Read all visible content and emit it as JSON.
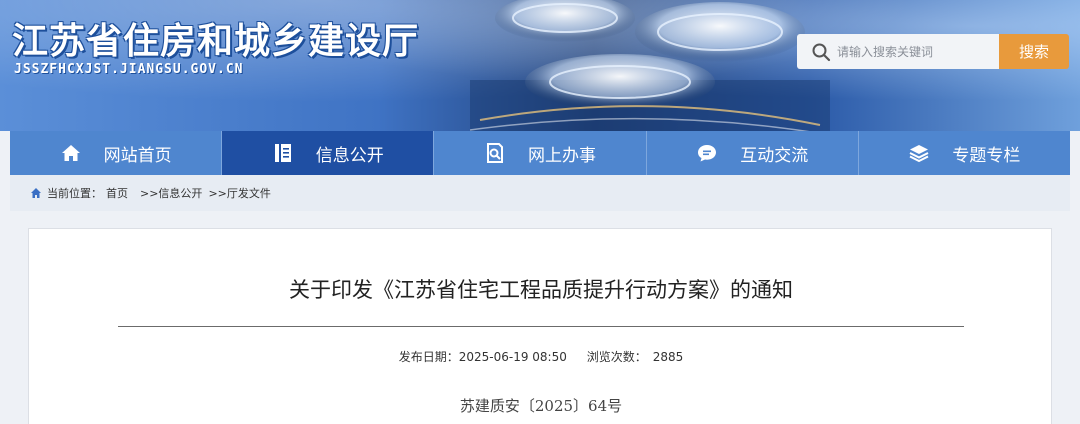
{
  "header": {
    "site_title": "江苏省住房和城乡建设厅",
    "site_domain": "JSSZFHCXJST.JIANGSU.GOV.CN",
    "search": {
      "placeholder": "请输入搜索关键词",
      "button_label": "搜索"
    }
  },
  "nav": {
    "items": [
      {
        "label": "网站首页",
        "icon": "home-icon",
        "active": false
      },
      {
        "label": "信息公开",
        "icon": "document-icon",
        "active": true
      },
      {
        "label": "网上办事",
        "icon": "search-document-icon",
        "active": false
      },
      {
        "label": "互动交流",
        "icon": "chat-icon",
        "active": false
      },
      {
        "label": "专题专栏",
        "icon": "layers-icon",
        "active": false
      }
    ]
  },
  "breadcrumb": {
    "prefix": "当前位置：",
    "items": [
      "首页",
      ">>信息公开",
      ">>厅发文件"
    ]
  },
  "article": {
    "title": "关于印发《江苏省住宅工程品质提升行动方案》的通知",
    "publish_label": "发布日期：",
    "publish_date": "2025-06-19 08:50",
    "views_label": "浏览次数：",
    "views": "2885",
    "doc_number": "苏建质安〔2025〕64号"
  },
  "colors": {
    "nav_bg": "#4f86cf",
    "nav_active_bg": "#1f4fa3",
    "search_button": "#e89a3c",
    "breadcrumb_bg": "#e7ecf3"
  }
}
